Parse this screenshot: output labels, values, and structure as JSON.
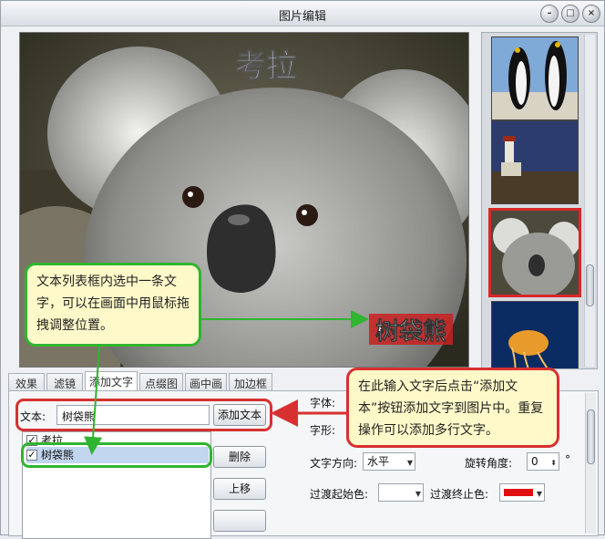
{
  "window": {
    "title": "图片编辑"
  },
  "preview": {
    "caption_top": "考拉",
    "caption_text": "树袋熊"
  },
  "tabs": [
    {
      "label": "效果",
      "active": false
    },
    {
      "label": "滤镜",
      "active": false
    },
    {
      "label": "添加文字",
      "active": true
    },
    {
      "label": "点缀图",
      "active": false
    },
    {
      "label": "画中画",
      "active": false
    },
    {
      "label": "加边框",
      "active": false
    }
  ],
  "panel": {
    "text_label": "文本:",
    "text_value": "树袋熊",
    "add_text_button": "添加文本",
    "list_items": [
      {
        "label": "考拉",
        "checked": true
      },
      {
        "label": "树袋熊",
        "checked": true
      }
    ],
    "delete_button": "删除",
    "move_up_button": "上移",
    "font_label": "字体:",
    "style_label": "字形:",
    "direction_label": "文字方向:",
    "direction_value": "水平",
    "rotation_label": "旋转角度:",
    "rotation_value": "0",
    "degree_symbol": "°",
    "gradient_start_label": "过渡起始色:",
    "gradient_end_label": "过渡终止色:",
    "gradient_start_color": "#ffffff",
    "gradient_end_color": "#e01010"
  },
  "callouts": {
    "left": "文本列表框内选中一条文字，可以在画面中用鼠标拖拽调整位置。",
    "right": "在此输入文字后点击“添加文本”按钮添加文字到图片中。重复操作可以添加多行文字。"
  },
  "colors": {
    "highlight_red": "#d83030",
    "highlight_green": "#2fb52f",
    "callout_bg": "#fff9c9"
  }
}
